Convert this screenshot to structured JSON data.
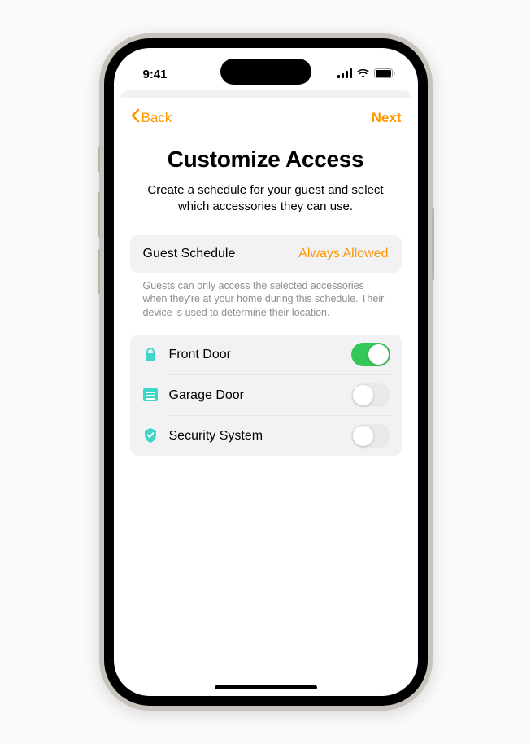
{
  "statusBar": {
    "time": "9:41"
  },
  "nav": {
    "back": "Back",
    "next": "Next"
  },
  "header": {
    "title": "Customize Access",
    "subtitle": "Create a schedule for your guest and select which accessories they can use."
  },
  "schedule": {
    "label": "Guest Schedule",
    "value": "Always Allowed",
    "footnote": "Guests can only access the selected accessories when they're at your home during this schedule. Their device is used to determine their location."
  },
  "accessories": [
    {
      "icon": "lock-icon",
      "label": "Front Door",
      "enabled": true
    },
    {
      "icon": "garage-icon",
      "label": "Garage Door",
      "enabled": false
    },
    {
      "icon": "shield-icon",
      "label": "Security System",
      "enabled": false
    }
  ],
  "colors": {
    "accent": "#ff9500",
    "iconTeal": "#3fd6c8",
    "toggleOn": "#34c759"
  }
}
